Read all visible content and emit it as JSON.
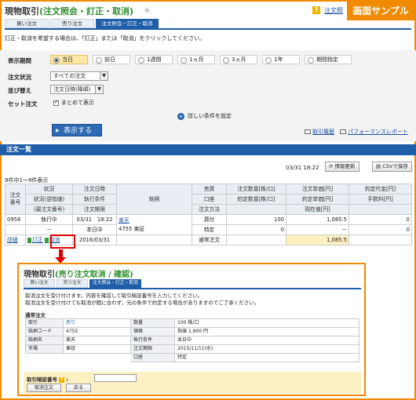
{
  "sample_label": "画面サンプル",
  "header": {
    "title": "現物取引",
    "subtitle": "(注文照会・訂正・取消)",
    "help_link": "注文照"
  },
  "tabs": [
    "買い注文",
    "売り注文",
    "注文照会・訂正・取消"
  ],
  "instruction": "訂正・取消を希望する場合は、「訂正」または「取消」をクリックしてください。",
  "filter": {
    "period_label": "表示期間",
    "period_options": [
      "当日",
      "前日",
      "1週間",
      "1ヵ月",
      "3ヵ月",
      "1年",
      "期間指定"
    ],
    "period_selected": "当日",
    "status_label": "注文状況",
    "status_value": "すべての注文",
    "sort_label": "並び替え",
    "sort_value": "注文日時(降順)",
    "set_label": "セット注文",
    "set_checkbox": "まとめて表示",
    "detail_link": "詳しい条件を設定",
    "show_button": "表示する",
    "links": [
      "取引履歴",
      "パフォーマンスレポート"
    ]
  },
  "list": {
    "title": "注文一覧",
    "timestamp": "03/31 18:22",
    "refresh_button": "情報更新",
    "csv_button": "CSVで保存",
    "count": "9件中1～9件表示",
    "headers": {
      "no": "注文\n番号",
      "status1": "状況",
      "status2": "状況(逆指値)",
      "status3": "(親注文番号)",
      "dt1": "注文日時",
      "dt2": "執行条件",
      "dt3": "注文期限",
      "brand": "銘柄",
      "side1": "売買",
      "side2": "口座",
      "side3": "注文方法",
      "qty1": "注文数量[株/口]",
      "qty2": "約定数量[株/口]",
      "price1": "注文単価[円]",
      "price2": "約定単価[円]",
      "price3": "現在値[円]",
      "amt1": "約定代金[円]",
      "amt2": "手数料[円]"
    },
    "row": {
      "no": "0958",
      "status": "執行中",
      "datetime": "03/31　18:22",
      "condition": "本日中",
      "deadline": "2016/03/31",
      "brand_name": "楽天",
      "brand_code": "4755 東証",
      "side": "買付",
      "account": "特定",
      "method": "通常注文",
      "qty": "100",
      "filled_qty": "0",
      "price": "1,085.5",
      "filled_price": "－",
      "current": "1,085.5",
      "amount": "0",
      "fee": "0",
      "detail_link": "詳細",
      "modify_link": "訂正",
      "cancel_link": "取消",
      "status2": "－"
    }
  },
  "confirm": {
    "title": "現物取引",
    "subtitle": "(売り注文取消 / 確認)",
    "tabs": [
      "買い注文",
      "売り注文",
      "注文照会・訂正・取消"
    ],
    "msg1": "取消注文を受け付けます。内容を確認して取引暗証番号を入力してください。",
    "msg2": "取消注文を受け付けても取消が間に合わず、元の条件で約定する場合がありますのでご了承ください。",
    "section": "通常注文",
    "rows": [
      [
        "取引",
        "売り",
        "数量",
        "100 株/口"
      ],
      [
        "銘柄コード",
        "4755",
        "価格",
        "指値 1,800 円"
      ],
      [
        "銘柄名",
        "楽天",
        "執行条件",
        "本日中"
      ],
      [
        "市場",
        "東証",
        "注文期限",
        "2015/11/11(水)"
      ],
      [
        "",
        "",
        "口座",
        "特定"
      ]
    ],
    "pin_label": "取引暗証番号",
    "cancel_button": "取消注文",
    "back_button": "戻る"
  }
}
